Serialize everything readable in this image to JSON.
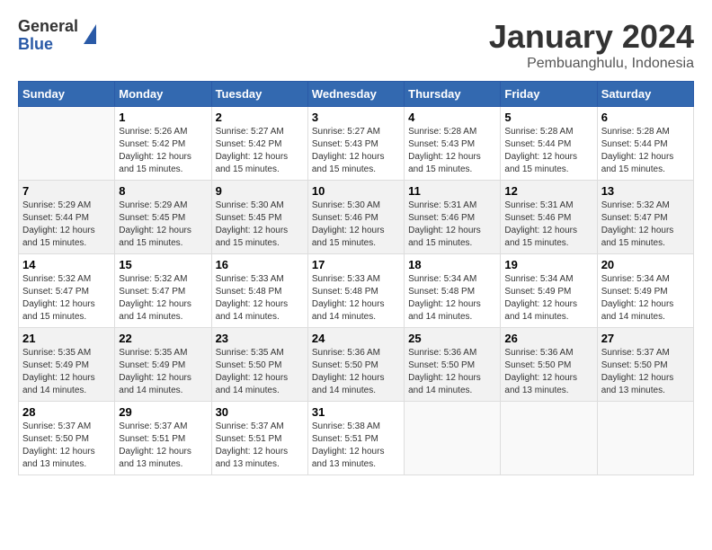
{
  "header": {
    "logo_general": "General",
    "logo_blue": "Blue",
    "month_year": "January 2024",
    "location": "Pembuanghulu, Indonesia"
  },
  "days_of_week": [
    "Sunday",
    "Monday",
    "Tuesday",
    "Wednesday",
    "Thursday",
    "Friday",
    "Saturday"
  ],
  "weeks": [
    [
      {
        "day": "",
        "info": ""
      },
      {
        "day": "1",
        "info": "Sunrise: 5:26 AM\nSunset: 5:42 PM\nDaylight: 12 hours\nand 15 minutes."
      },
      {
        "day": "2",
        "info": "Sunrise: 5:27 AM\nSunset: 5:42 PM\nDaylight: 12 hours\nand 15 minutes."
      },
      {
        "day": "3",
        "info": "Sunrise: 5:27 AM\nSunset: 5:43 PM\nDaylight: 12 hours\nand 15 minutes."
      },
      {
        "day": "4",
        "info": "Sunrise: 5:28 AM\nSunset: 5:43 PM\nDaylight: 12 hours\nand 15 minutes."
      },
      {
        "day": "5",
        "info": "Sunrise: 5:28 AM\nSunset: 5:44 PM\nDaylight: 12 hours\nand 15 minutes."
      },
      {
        "day": "6",
        "info": "Sunrise: 5:28 AM\nSunset: 5:44 PM\nDaylight: 12 hours\nand 15 minutes."
      }
    ],
    [
      {
        "day": "7",
        "info": "Sunrise: 5:29 AM\nSunset: 5:44 PM\nDaylight: 12 hours\nand 15 minutes."
      },
      {
        "day": "8",
        "info": "Sunrise: 5:29 AM\nSunset: 5:45 PM\nDaylight: 12 hours\nand 15 minutes."
      },
      {
        "day": "9",
        "info": "Sunrise: 5:30 AM\nSunset: 5:45 PM\nDaylight: 12 hours\nand 15 minutes."
      },
      {
        "day": "10",
        "info": "Sunrise: 5:30 AM\nSunset: 5:46 PM\nDaylight: 12 hours\nand 15 minutes."
      },
      {
        "day": "11",
        "info": "Sunrise: 5:31 AM\nSunset: 5:46 PM\nDaylight: 12 hours\nand 15 minutes."
      },
      {
        "day": "12",
        "info": "Sunrise: 5:31 AM\nSunset: 5:46 PM\nDaylight: 12 hours\nand 15 minutes."
      },
      {
        "day": "13",
        "info": "Sunrise: 5:32 AM\nSunset: 5:47 PM\nDaylight: 12 hours\nand 15 minutes."
      }
    ],
    [
      {
        "day": "14",
        "info": "Sunrise: 5:32 AM\nSunset: 5:47 PM\nDaylight: 12 hours\nand 15 minutes."
      },
      {
        "day": "15",
        "info": "Sunrise: 5:32 AM\nSunset: 5:47 PM\nDaylight: 12 hours\nand 14 minutes."
      },
      {
        "day": "16",
        "info": "Sunrise: 5:33 AM\nSunset: 5:48 PM\nDaylight: 12 hours\nand 14 minutes."
      },
      {
        "day": "17",
        "info": "Sunrise: 5:33 AM\nSunset: 5:48 PM\nDaylight: 12 hours\nand 14 minutes."
      },
      {
        "day": "18",
        "info": "Sunrise: 5:34 AM\nSunset: 5:48 PM\nDaylight: 12 hours\nand 14 minutes."
      },
      {
        "day": "19",
        "info": "Sunrise: 5:34 AM\nSunset: 5:49 PM\nDaylight: 12 hours\nand 14 minutes."
      },
      {
        "day": "20",
        "info": "Sunrise: 5:34 AM\nSunset: 5:49 PM\nDaylight: 12 hours\nand 14 minutes."
      }
    ],
    [
      {
        "day": "21",
        "info": "Sunrise: 5:35 AM\nSunset: 5:49 PM\nDaylight: 12 hours\nand 14 minutes."
      },
      {
        "day": "22",
        "info": "Sunrise: 5:35 AM\nSunset: 5:49 PM\nDaylight: 12 hours\nand 14 minutes."
      },
      {
        "day": "23",
        "info": "Sunrise: 5:35 AM\nSunset: 5:50 PM\nDaylight: 12 hours\nand 14 minutes."
      },
      {
        "day": "24",
        "info": "Sunrise: 5:36 AM\nSunset: 5:50 PM\nDaylight: 12 hours\nand 14 minutes."
      },
      {
        "day": "25",
        "info": "Sunrise: 5:36 AM\nSunset: 5:50 PM\nDaylight: 12 hours\nand 14 minutes."
      },
      {
        "day": "26",
        "info": "Sunrise: 5:36 AM\nSunset: 5:50 PM\nDaylight: 12 hours\nand 13 minutes."
      },
      {
        "day": "27",
        "info": "Sunrise: 5:37 AM\nSunset: 5:50 PM\nDaylight: 12 hours\nand 13 minutes."
      }
    ],
    [
      {
        "day": "28",
        "info": "Sunrise: 5:37 AM\nSunset: 5:50 PM\nDaylight: 12 hours\nand 13 minutes."
      },
      {
        "day": "29",
        "info": "Sunrise: 5:37 AM\nSunset: 5:51 PM\nDaylight: 12 hours\nand 13 minutes."
      },
      {
        "day": "30",
        "info": "Sunrise: 5:37 AM\nSunset: 5:51 PM\nDaylight: 12 hours\nand 13 minutes."
      },
      {
        "day": "31",
        "info": "Sunrise: 5:38 AM\nSunset: 5:51 PM\nDaylight: 12 hours\nand 13 minutes."
      },
      {
        "day": "",
        "info": ""
      },
      {
        "day": "",
        "info": ""
      },
      {
        "day": "",
        "info": ""
      }
    ]
  ]
}
